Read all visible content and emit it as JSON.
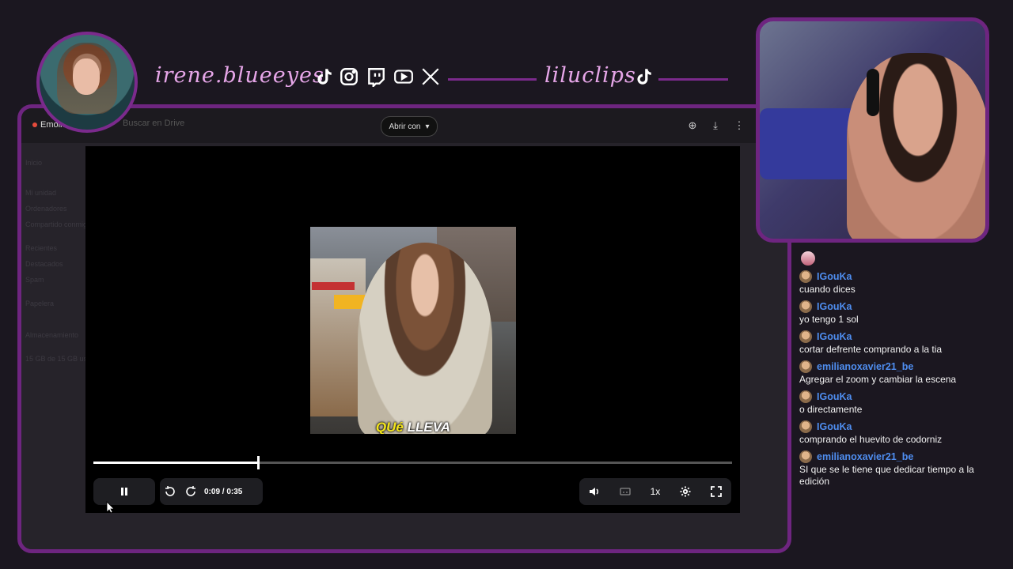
{
  "overlay": {
    "streamer_name": "irene.blueeyes",
    "clips_name": "liluclips",
    "social_icons": [
      "tiktok-icon",
      "instagram-icon",
      "twitch-icon",
      "youtube-icon",
      "x-icon"
    ],
    "accent_color": "#6e2580"
  },
  "drive": {
    "file_title": "Emoliente_",
    "search_placeholder": "Buscar en Drive",
    "open_with_label": "Abrir con",
    "toolbar_icons": [
      "add-to-drive-icon",
      "download-icon",
      "more-vert-icon"
    ],
    "sidebar_ghost": [
      "Inicio",
      "Mi unidad",
      "Ordenadores",
      "Compartido conmigo",
      "Recientes",
      "Destacados",
      "Spam",
      "Papelera",
      "Almacenamiento",
      "15 GB de 15 GB usado"
    ]
  },
  "player": {
    "progress": 0.257,
    "time": "0:09 / 0:35",
    "speed": "1x",
    "caption_highlight": "QUé",
    "caption_rest": " LLEVA"
  },
  "chat": {
    "messages": [
      {
        "user": "IGouKa",
        "text": "cuando dices"
      },
      {
        "user": "IGouKa",
        "text": "yo tengo 1 sol"
      },
      {
        "user": "IGouKa",
        "text": "cortar defrente comprando a la tia"
      },
      {
        "user": "emilianoxavier21_be",
        "text": "Agregar el zoom y cambiar la escena"
      },
      {
        "user": "IGouKa",
        "text": "o directamente"
      },
      {
        "user": "IGouKa",
        "text": "comprando el huevito de codorniz"
      },
      {
        "user": "emilianoxavier21_be",
        "text": "SI que se le tiene que dedicar tiempo a la edición"
      }
    ]
  }
}
